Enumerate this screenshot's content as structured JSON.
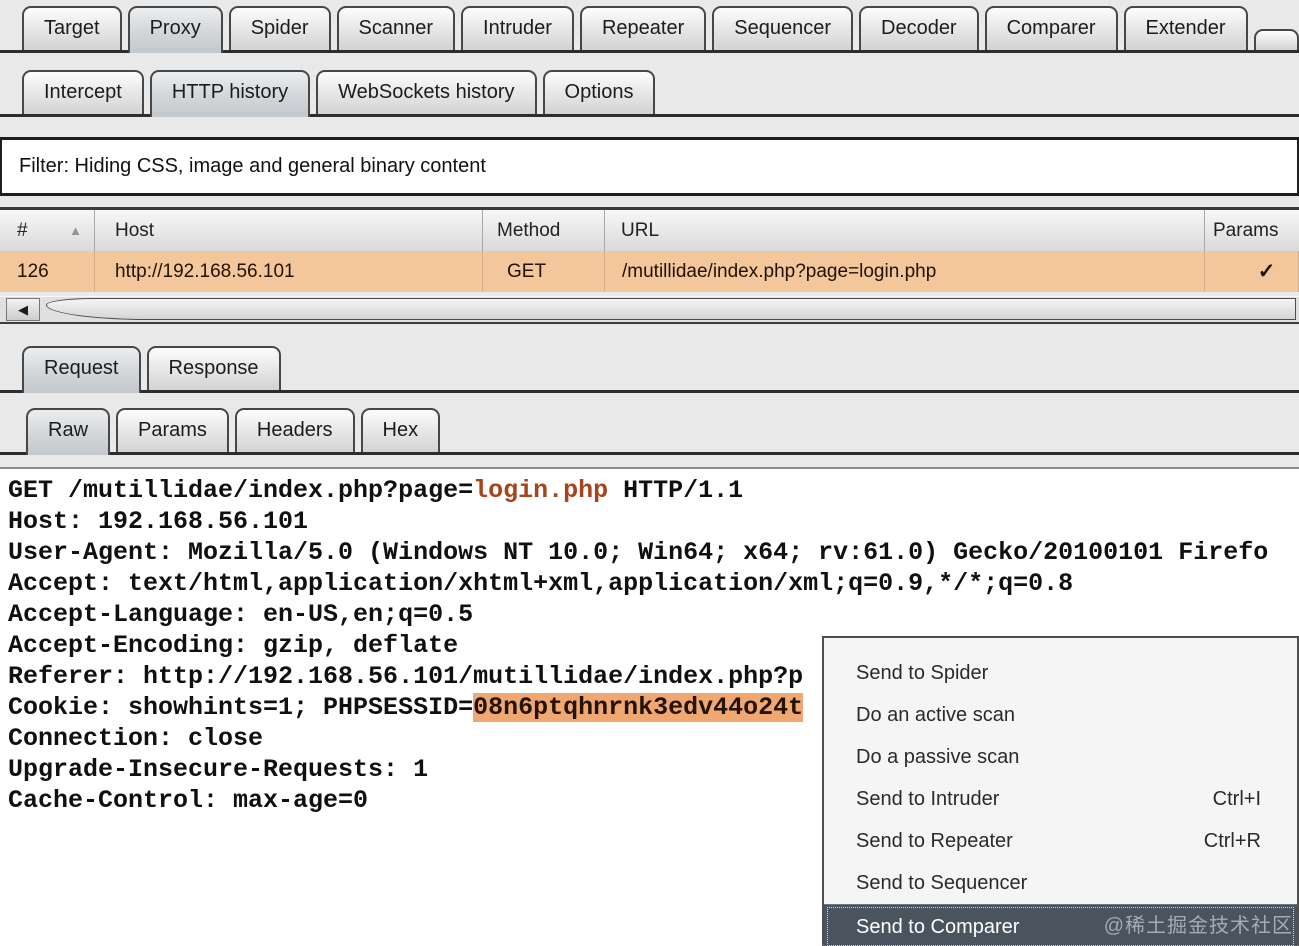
{
  "main_tabs": {
    "items": [
      {
        "label": "Target"
      },
      {
        "label": "Proxy",
        "selected": true
      },
      {
        "label": "Spider"
      },
      {
        "label": "Scanner"
      },
      {
        "label": "Intruder"
      },
      {
        "label": "Repeater"
      },
      {
        "label": "Sequencer"
      },
      {
        "label": "Decoder"
      },
      {
        "label": "Comparer"
      },
      {
        "label": "Extender"
      },
      {
        "label": "",
        "partial": true
      }
    ]
  },
  "proxy_tabs": {
    "items": [
      {
        "label": "Intercept"
      },
      {
        "label": "HTTP history",
        "selected": true
      },
      {
        "label": "WebSockets history"
      },
      {
        "label": "Options"
      }
    ]
  },
  "filter_bar": {
    "text": "Filter: Hiding CSS, image and general binary content"
  },
  "history_table": {
    "columns": [
      "#",
      "Host",
      "Method",
      "URL",
      "Params"
    ],
    "sort_indicator": "▲",
    "rows": [
      {
        "num": "126",
        "host": "http://192.168.56.101",
        "method": "GET",
        "url": "/mutillidae/index.php?page=login.php",
        "params": "✓"
      }
    ]
  },
  "icons": {
    "scroll_left": "◀"
  },
  "message_tabs": {
    "items": [
      {
        "label": "Request",
        "selected": true
      },
      {
        "label": "Response"
      }
    ]
  },
  "view_tabs": {
    "items": [
      {
        "label": "Raw",
        "selected": true
      },
      {
        "label": "Params"
      },
      {
        "label": "Headers"
      },
      {
        "label": "Hex"
      }
    ]
  },
  "request_editor": {
    "lines": [
      {
        "pre": "GET /mutillidae/index.php?page=",
        "hl": "login.php",
        "hl_style": "param",
        "post": " HTTP/1.1"
      },
      {
        "pre": "Host: 192.168.56.101"
      },
      {
        "pre": "User-Agent: Mozilla/5.0 (Windows NT 10.0; Win64; x64; rv:61.0) Gecko/20100101 Firefo"
      },
      {
        "pre": "Accept: text/html,application/xhtml+xml,application/xml;q=0.9,*/*;q=0.8"
      },
      {
        "pre": "Accept-Language: en-US,en;q=0.5"
      },
      {
        "pre": "Accept-Encoding: gzip, deflate"
      },
      {
        "pre": "Referer: http://192.168.56.101/mutillidae/index.php?p"
      },
      {
        "pre": "Cookie: showhints=1; PHPSESSID=",
        "hl": "08n6ptqhnrnk3edv44o24t",
        "hl_style": "selection",
        "post": ""
      },
      {
        "pre": "Connection: close"
      },
      {
        "pre": "Upgrade-Insecure-Requests: 1"
      },
      {
        "pre": "Cache-Control: max-age=0"
      }
    ]
  },
  "context_menu": {
    "items": [
      {
        "label": "Send to Spider"
      },
      {
        "label": "Do an active scan"
      },
      {
        "label": "Do a passive scan"
      },
      {
        "label": "Send to Intruder",
        "shortcut": "Ctrl+I"
      },
      {
        "label": "Send to Repeater",
        "shortcut": "Ctrl+R"
      },
      {
        "label": "Send to Sequencer"
      },
      {
        "label": "Send to Comparer",
        "selected": true
      }
    ]
  },
  "watermark": "@稀土掘金技术社区",
  "colors": {
    "row_highlight": "#f4c69c",
    "cookie_highlight_bg": "#f0a873",
    "param_text": "#a8431c",
    "menu_selected_bg": "#4a545f",
    "menu_selected_text": "#ffffff"
  }
}
